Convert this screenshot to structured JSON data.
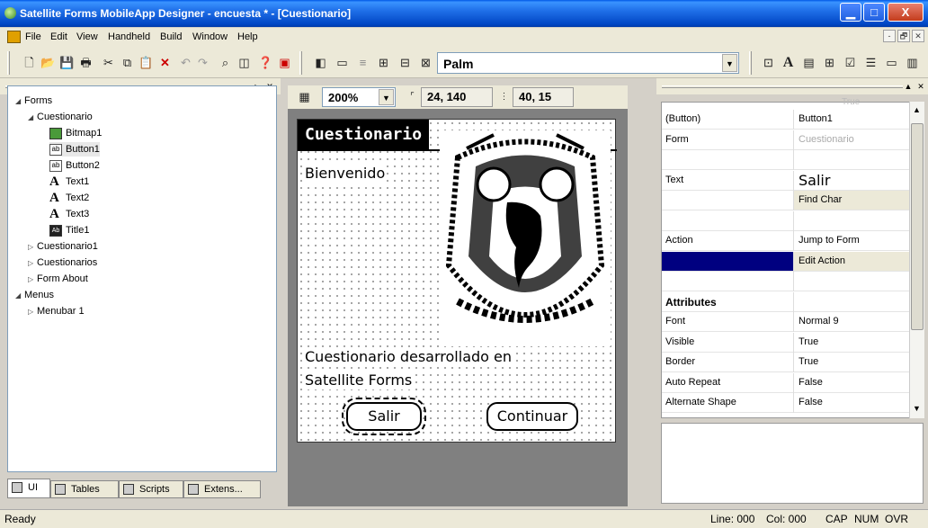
{
  "window": {
    "title": "Satellite Forms MobileApp Designer - encuesta * - [Cuestionario]",
    "min": "▁",
    "max": "□",
    "close": "X"
  },
  "menu": {
    "items": [
      "File",
      "Edit",
      "View",
      "Handheld",
      "Build",
      "Window",
      "Help"
    ],
    "mdi": [
      "-",
      "🗗",
      "✕"
    ]
  },
  "toolbar": {
    "platform": "Palm",
    "icons": [
      "new-icon",
      "open-icon",
      "save-icon",
      "print-icon",
      "cut-icon",
      "copy-icon",
      "paste-icon",
      "delete-icon",
      "undo-icon",
      "redo-icon",
      "find-icon",
      "binoculars-icon",
      "help-icon",
      "calendar-icon",
      "wizard-icon",
      "form-icon",
      "align-icon",
      "chart-icon",
      "tables-icon",
      "grid-icon"
    ],
    "right_icons": [
      "label-icon",
      "text-icon",
      "field-icon",
      "paste-icon",
      "checkbox-icon",
      "list-icon",
      "button-icon",
      "dropdown-icon"
    ]
  },
  "tree": {
    "items": [
      {
        "label": "Forms",
        "indent": 0,
        "icon": "form",
        "exp": "◢"
      },
      {
        "label": "Cuestionario",
        "indent": 1,
        "icon": "form",
        "exp": "◢"
      },
      {
        "label": "Bitmap1",
        "indent": 2,
        "icon": "bmp"
      },
      {
        "label": "Button1",
        "indent": 2,
        "icon": "btn",
        "sel": true
      },
      {
        "label": "Button2",
        "indent": 2,
        "icon": "btn"
      },
      {
        "label": "Text1",
        "indent": 2,
        "icon": "txt"
      },
      {
        "label": "Text2",
        "indent": 2,
        "icon": "txt"
      },
      {
        "label": "Text3",
        "indent": 2,
        "icon": "txt"
      },
      {
        "label": "Title1",
        "indent": 2,
        "icon": "title"
      },
      {
        "label": "Cuestionario1",
        "indent": 1,
        "icon": "form",
        "exp": "▷"
      },
      {
        "label": "Cuestionarios",
        "indent": 1,
        "icon": "form",
        "exp": "▷"
      },
      {
        "label": "Form About",
        "indent": 1,
        "icon": "form",
        "exp": "▷"
      },
      {
        "label": "Menus",
        "indent": 0,
        "icon": "form",
        "exp": "◢"
      },
      {
        "label": "Menubar 1",
        "indent": 1,
        "icon": "form",
        "exp": "▷"
      }
    ]
  },
  "tabs": [
    {
      "label": "UI"
    },
    {
      "label": "Tables"
    },
    {
      "label": "Scripts"
    },
    {
      "label": "Extens..."
    }
  ],
  "designer": {
    "zoom": "200%",
    "pos": "24, 140",
    "size": "40, 15"
  },
  "form": {
    "title": "Cuestionario",
    "text1": "Bienvenido",
    "text2": "Cuestionario desarrollado en",
    "text3": "Satellite Forms",
    "button1": "Salir",
    "button2": "Continuar"
  },
  "props": {
    "hint": "True",
    "rows": [
      {
        "k": "(Button)",
        "v": "Button1"
      },
      {
        "k": "Form",
        "v": "Cuestionario",
        "dim": true
      },
      {
        "k": "",
        "v": ""
      },
      {
        "k": "Text",
        "v": "Salir",
        "big": true
      },
      {
        "k": "",
        "v": "Find Char",
        "btn": true
      },
      {
        "k": "",
        "v": ""
      },
      {
        "k": "Action",
        "v": "Jump to Form"
      },
      {
        "k": "",
        "v": "Edit Action",
        "btn": true,
        "selected": true
      },
      {
        "k": "",
        "v": ""
      },
      {
        "k": "Attributes",
        "v": "",
        "bold": true
      },
      {
        "k": "Font",
        "v": "Normal  9"
      },
      {
        "k": "Visible",
        "v": "True"
      },
      {
        "k": "Border",
        "v": "True"
      },
      {
        "k": "Auto Repeat",
        "v": "False"
      },
      {
        "k": "Alternate Shape",
        "v": "False"
      }
    ]
  },
  "status": {
    "left": "Ready",
    "line": "Line: 000",
    "col": "Col: 000",
    "cap": "CAP",
    "num": "NUM",
    "ovr": "OVR"
  }
}
